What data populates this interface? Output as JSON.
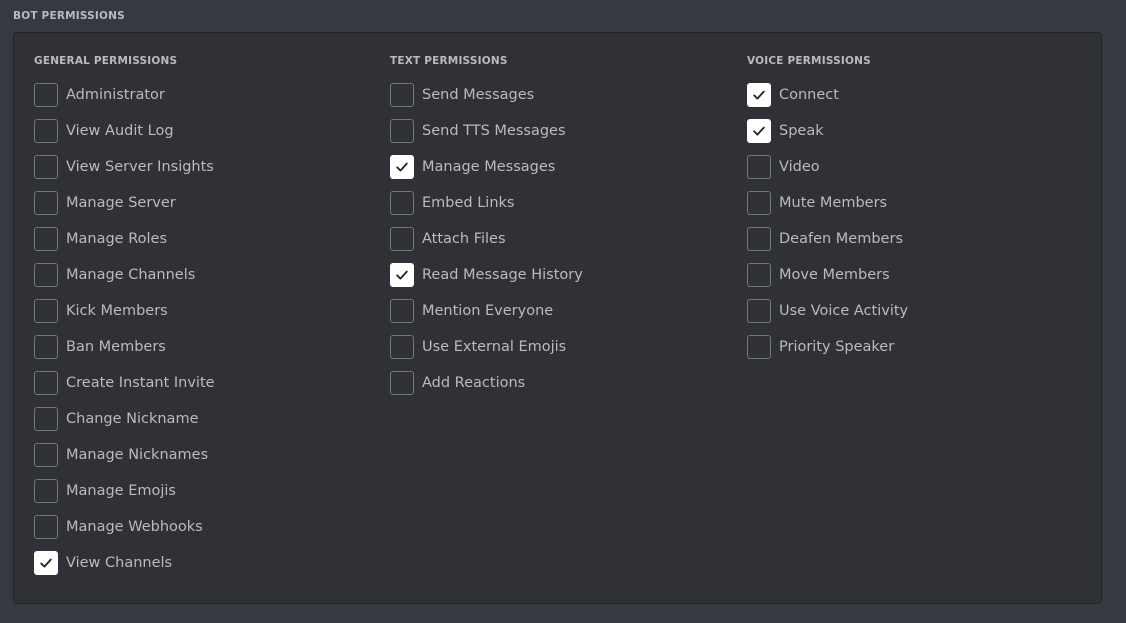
{
  "section_title": "BOT PERMISSIONS",
  "colors": {
    "background": "#36393f",
    "panel": "#2f3136",
    "text": "#b9bbbe",
    "checked": "#ffffff"
  },
  "columns": [
    {
      "header": "GENERAL PERMISSIONS",
      "items": [
        {
          "label": "Administrator",
          "checked": false
        },
        {
          "label": "View Audit Log",
          "checked": false
        },
        {
          "label": "View Server Insights",
          "checked": false
        },
        {
          "label": "Manage Server",
          "checked": false
        },
        {
          "label": "Manage Roles",
          "checked": false
        },
        {
          "label": "Manage Channels",
          "checked": false
        },
        {
          "label": "Kick Members",
          "checked": false
        },
        {
          "label": "Ban Members",
          "checked": false
        },
        {
          "label": "Create Instant Invite",
          "checked": false
        },
        {
          "label": "Change Nickname",
          "checked": false
        },
        {
          "label": "Manage Nicknames",
          "checked": false
        },
        {
          "label": "Manage Emojis",
          "checked": false
        },
        {
          "label": "Manage Webhooks",
          "checked": false
        },
        {
          "label": "View Channels",
          "checked": true
        }
      ]
    },
    {
      "header": "TEXT PERMISSIONS",
      "items": [
        {
          "label": "Send Messages",
          "checked": false
        },
        {
          "label": "Send TTS Messages",
          "checked": false
        },
        {
          "label": "Manage Messages",
          "checked": true
        },
        {
          "label": "Embed Links",
          "checked": false
        },
        {
          "label": "Attach Files",
          "checked": false
        },
        {
          "label": "Read Message History",
          "checked": true
        },
        {
          "label": "Mention Everyone",
          "checked": false
        },
        {
          "label": "Use External Emojis",
          "checked": false
        },
        {
          "label": "Add Reactions",
          "checked": false
        }
      ]
    },
    {
      "header": "VOICE PERMISSIONS",
      "items": [
        {
          "label": "Connect",
          "checked": true
        },
        {
          "label": "Speak",
          "checked": true
        },
        {
          "label": "Video",
          "checked": false
        },
        {
          "label": "Mute Members",
          "checked": false
        },
        {
          "label": "Deafen Members",
          "checked": false
        },
        {
          "label": "Move Members",
          "checked": false
        },
        {
          "label": "Use Voice Activity",
          "checked": false
        },
        {
          "label": "Priority Speaker",
          "checked": false
        }
      ]
    }
  ]
}
